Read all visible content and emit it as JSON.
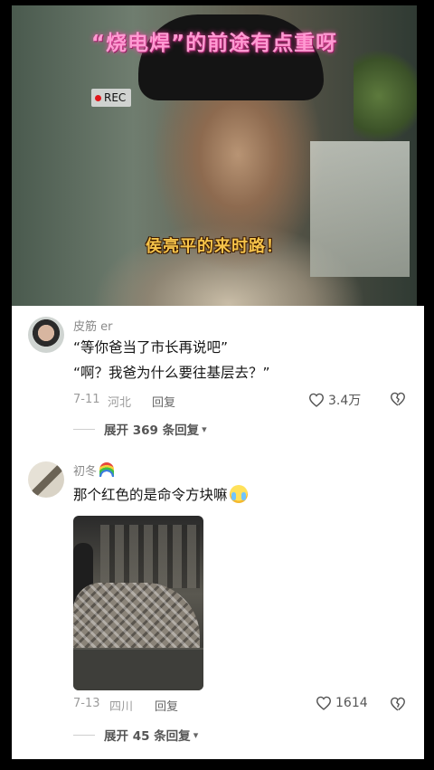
{
  "video": {
    "title": "“烧电焊”的前途有点重呀",
    "rec_label": "REC",
    "subtitle": "侯亮平的来时路！"
  },
  "comments": [
    {
      "username": "皮筋 er",
      "text_lines": [
        "“等你爸当了市长再说吧”",
        "“啊？我爸为什么要往基层去？”"
      ],
      "date": "7-11",
      "location": "河北",
      "reply_label": "回复",
      "likes": "3.4万",
      "expand_label": "展开 369 条回复"
    },
    {
      "username": "初冬",
      "text": "那个红色的是命令方块嘛",
      "date": "7-13",
      "location": "四川",
      "reply_label": "回复",
      "likes": "1614",
      "expand_label": "展开 45 条回复"
    }
  ],
  "icons": {
    "like": "heart-outline-icon",
    "dislike": "broken-heart-icon",
    "expand": "chevron-down-icon",
    "rec": "record-dot-icon"
  },
  "colors": {
    "title_pink": "#ff9ad2",
    "subtitle_gold": "#f6c34a",
    "rec_red": "#e0151a"
  }
}
